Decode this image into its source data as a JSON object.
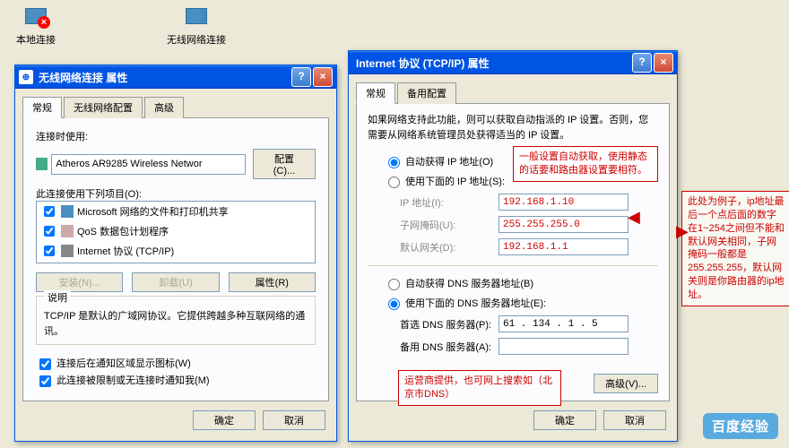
{
  "desktop": {
    "local_conn": "本地连接",
    "wireless_conn": "无线网络连接"
  },
  "win1": {
    "title": "无线网络连接 属性",
    "tabs": {
      "general": "常规",
      "wireless": "无线网络配置",
      "advanced": "高级"
    },
    "connect_using_label": "连接时使用:",
    "adapter": "Atheros AR9285 Wireless Networ",
    "configure_btn": "配置(C)...",
    "items_label": "此连接使用下列项目(O):",
    "items": [
      "Microsoft 网络的文件和打印机共享",
      "QoS 数据包计划程序",
      "Internet 协议 (TCP/IP)"
    ],
    "install_btn": "安装(N)...",
    "uninstall_btn": "卸载(U)",
    "properties_btn": "属性(R)",
    "desc_title": "说明",
    "desc_text": "TCP/IP 是默认的广域网协议。它提供跨越多种互联网络的通讯。",
    "chk_tray": "连接后在通知区域显示图标(W)",
    "chk_limited": "此连接被限制或无连接时通知我(M)",
    "ok": "确定",
    "cancel": "取消"
  },
  "win2": {
    "title": "Internet 协议 (TCP/IP) 属性",
    "tabs": {
      "general": "常规",
      "alternate": "备用配置"
    },
    "intro": "如果网络支持此功能，则可以获取自动指派的 IP 设置。否则，您需要从网络系统管理员处获得适当的 IP 设置。",
    "radio_auto_ip": "自动获得 IP 地址(O)",
    "radio_manual_ip": "使用下面的 IP 地址(S):",
    "ip_label": "IP 地址(I):",
    "mask_label": "子网掩码(U):",
    "gw_label": "默认网关(D):",
    "ip_value": "192.168.1.10",
    "mask_value": "255.255.255.0",
    "gw_value": "192.168.1.1",
    "radio_auto_dns": "自动获得 DNS 服务器地址(B)",
    "radio_manual_dns": "使用下面的 DNS 服务器地址(E):",
    "dns1_label": "首选 DNS 服务器(P):",
    "dns2_label": "备用 DNS 服务器(A):",
    "dns1_value": "61 . 134 . 1  . 5",
    "dns2_value": "",
    "adv_btn": "高级(V)...",
    "ok": "确定",
    "cancel": "取消"
  },
  "annot": {
    "a1": "一般设置自动获取，使用静态的话要和路由器设置要相符。",
    "a2": "此处为例子，ip地址最后一个点后面的数字在1~254之间但不能和默认网关相同，子网掩码一般都是255.255.255，默认网关则是你路由器的ip地址。",
    "a3": "运营商提供，也可网上搜索如（北京市DNS）"
  },
  "watermark": "百度经验"
}
